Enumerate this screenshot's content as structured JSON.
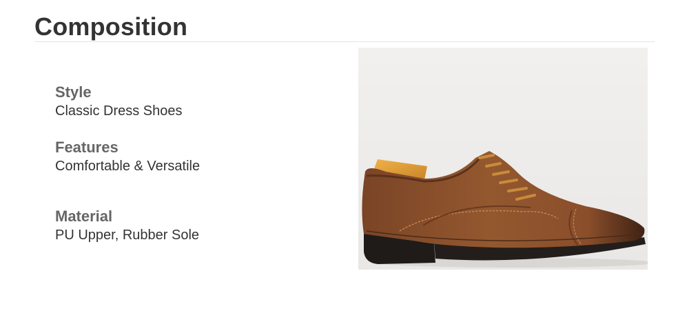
{
  "section": {
    "title": "Composition"
  },
  "specs": [
    {
      "label": "Style",
      "value": "Classic Dress Shoes"
    },
    {
      "label": "Features",
      "value": "Comfortable & Versatile"
    },
    {
      "label": "Material",
      "value": "PU Upper, Rubber Sole"
    }
  ],
  "product_image": {
    "subject": "brown cap-toe oxford dress shoe with wooden shoe tree",
    "colors": {
      "leather": "#8a4f2c",
      "sole": "#1f1b19",
      "laces": "#c98a3c",
      "shoe_tree": "#e2a23f",
      "background": "#efeeec"
    }
  }
}
